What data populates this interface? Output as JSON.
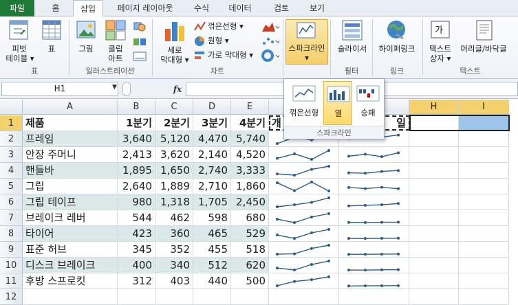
{
  "tabs": [
    "파일",
    "홈",
    "삽입",
    "페이지 레이아웃",
    "수식",
    "데이터",
    "검토",
    "보기"
  ],
  "ribbon": {
    "groups": {
      "table": "표",
      "illustrations": "일러스트레이션",
      "charts": "차트",
      "sparklines": "스파크라인",
      "filter": "필터",
      "links": "링크",
      "text": "텍스트"
    },
    "buttons": {
      "pivot_line1": "피벗",
      "pivot_line2": "테이블 ▾",
      "table": "표",
      "picture": "그림",
      "clipart_line1": "클립",
      "clipart_line2": "아트",
      "column_line1": "세로",
      "column_line2": "막대형 ▾",
      "line": "꺾은선형 ▾",
      "pie": "원형 ▾",
      "bar": "가로 막대형 ▾",
      "sparkline": "스파크라인",
      "sparkline_arrow": "▾",
      "slicer": "슬라이서",
      "hyperlink": "하이퍼링크",
      "textbox_line1": "텍스트",
      "textbox_line2": "상자 ▾",
      "headerfooter": "머리글/바닥글"
    }
  },
  "formula_bar": {
    "name_box": "H1",
    "fx": "fx"
  },
  "sparkline_menu": {
    "options": [
      "꺾은선형",
      "열",
      "승패"
    ],
    "highlighted": "열",
    "footer": "스파크라인"
  },
  "columns": [
    "A",
    "B",
    "C",
    "D",
    "E",
    "F",
    "G",
    "H",
    "I"
  ],
  "rows": [
    "1",
    "2",
    "3",
    "4",
    "5",
    "6",
    "7",
    "8",
    "9",
    "10",
    "11",
    "12"
  ],
  "headers": {
    "A": "제품",
    "B": "1분기",
    "C": "2분기",
    "D": "3분기",
    "E": "4분기",
    "F_visible": "개",
    "G_visible": "일"
  },
  "products": [
    {
      "name": "프레임",
      "q": [
        "3,640",
        "5,120",
        "4,470",
        "5,740"
      ]
    },
    {
      "name": "안장 주머니",
      "q": [
        "2,413",
        "3,620",
        "2,140",
        "4,520"
      ]
    },
    {
      "name": "핸들바",
      "q": [
        "1,895",
        "1,650",
        "2,740",
        "3,333"
      ]
    },
    {
      "name": "그립",
      "q": [
        "2,640",
        "1,889",
        "2,710",
        "1,860"
      ]
    },
    {
      "name": "그립 테이프",
      "q": [
        "980",
        "1,318",
        "1,705",
        "2,450"
      ]
    },
    {
      "name": "브레이크 레버",
      "q": [
        "544",
        "462",
        "598",
        "680"
      ]
    },
    {
      "name": "타이어",
      "q": [
        "423",
        "360",
        "465",
        "529"
      ]
    },
    {
      "name": "표준 허브",
      "q": [
        "345",
        "352",
        "455",
        "518"
      ]
    },
    {
      "name": "디스크 브레이크",
      "q": [
        "400",
        "340",
        "512",
        "620"
      ]
    },
    {
      "name": "후방 스프로킷",
      "q": [
        "312",
        "403",
        "440",
        "500"
      ]
    }
  ],
  "colors": {
    "band": "#dbe9e8",
    "selection": "#f4d16b",
    "sparkline": "#2a5b8f",
    "file_tab": "#1f7a38"
  }
}
